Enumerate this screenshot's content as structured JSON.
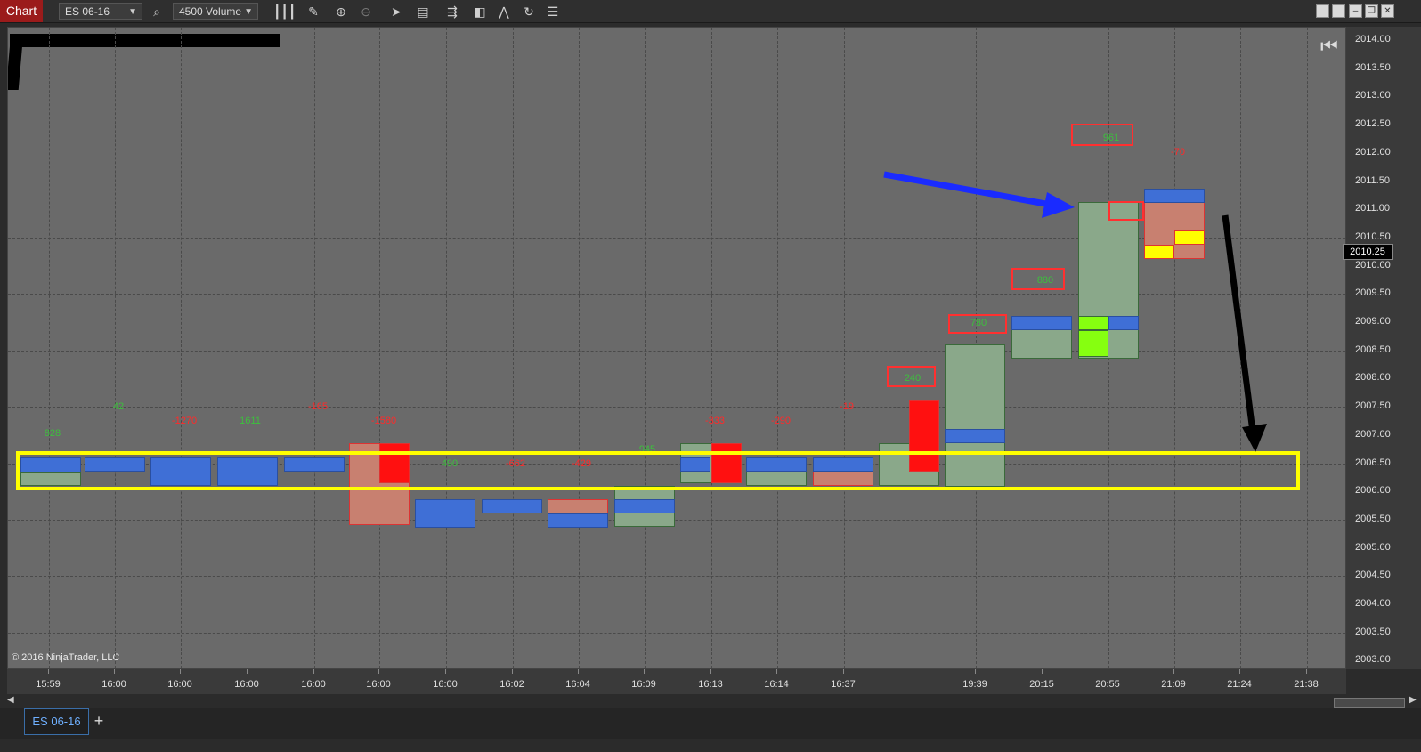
{
  "toolbar": {
    "chart_label": "Chart",
    "instrument": "ES 06-16",
    "period": "4500 Volume",
    "icons": [
      "search-icon",
      "bar-type-icon",
      "draw-pencil-icon",
      "zoom-in-icon",
      "zoom-out-icon",
      "pointer-icon",
      "data-box-icon",
      "strategy-icon",
      "indicator-icon",
      "chart-trader-icon",
      "reload-icon",
      "properties-icon"
    ]
  },
  "window_buttons": [
    "restore",
    "maximize",
    "minimize",
    "tile",
    "close"
  ],
  "copyright": "© 2016 NinjaTrader, LLC",
  "price_axis": [
    "2014.00",
    "2013.50",
    "2013.00",
    "2012.50",
    "2012.00",
    "2011.50",
    "2011.00",
    "2010.50",
    "2010.00",
    "2009.50",
    "2009.00",
    "2008.50",
    "2008.00",
    "2007.50",
    "2007.00",
    "2006.50",
    "2006.00",
    "2005.50",
    "2005.00",
    "2004.50",
    "2004.00",
    "2003.50",
    "2003.00"
  ],
  "current_price": "2010.25",
  "time_axis": [
    "15:59",
    "16:00",
    "16:00",
    "16:00",
    "16:00",
    "16:00",
    "16:00",
    "16:02",
    "16:04",
    "16:09",
    "16:13",
    "16:14",
    "16:37",
    "19:39",
    "20:15",
    "20:55",
    "21:09",
    "21:24",
    "21:38"
  ],
  "deltas": [
    {
      "text": "828",
      "color": "#3dbf3d"
    },
    {
      "text": "42",
      "color": "#3dbf3d"
    },
    {
      "text": "-1270",
      "color": "#ff2a2a"
    },
    {
      "text": "1611",
      "color": "#3dbf3d"
    },
    {
      "text": "-165",
      "color": "#ff2a2a"
    },
    {
      "text": "-1580",
      "color": "#ff2a2a"
    },
    {
      "text": "490",
      "color": "#3dbf3d"
    },
    {
      "text": "-662",
      "color": "#ff2a2a"
    },
    {
      "text": "-429",
      "color": "#ff2a2a"
    },
    {
      "text": "945",
      "color": "#3dbf3d"
    },
    {
      "text": "-333",
      "color": "#ff2a2a"
    },
    {
      "text": "-290",
      "color": "#ff2a2a"
    },
    {
      "text": "-19",
      "color": "#ff2a2a"
    },
    {
      "text": "240",
      "color": "#3dbf3d"
    },
    {
      "text": "780",
      "color": "#3dbf3d"
    },
    {
      "text": "880",
      "color": "#3dbf3d"
    },
    {
      "text": "961",
      "color": "#3dbf3d"
    },
    {
      "text": "-70",
      "color": "#ff2a2a"
    }
  ],
  "tab": {
    "instrument": "ES 06-16",
    "add": "+"
  }
}
